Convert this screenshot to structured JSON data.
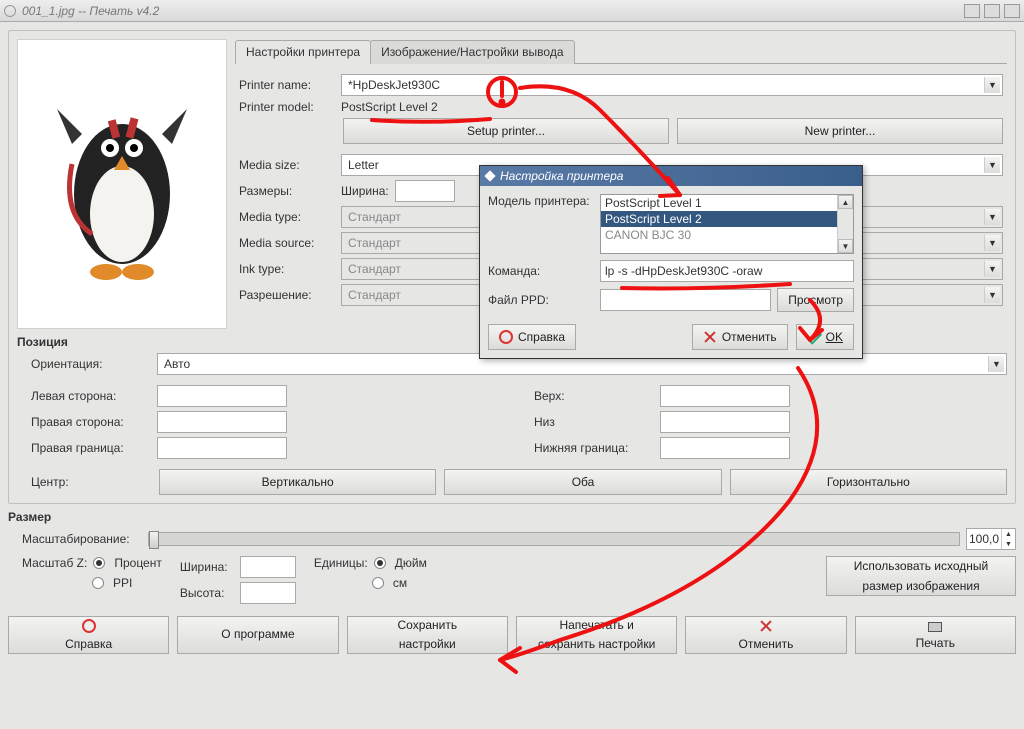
{
  "window": {
    "title": "001_1.jpg -- Печать v4.2"
  },
  "tabs": {
    "printer_settings": "Настройки принтера",
    "image_output": "Изображение/Настройки вывода"
  },
  "printer": {
    "name_label": "Printer name:",
    "name_value": "*HpDeskJet930C",
    "model_label": "Printer model:",
    "model_value": "PostScript Level 2",
    "setup_btn": "Setup printer...",
    "new_btn": "New printer..."
  },
  "media": {
    "size_label": "Media size:",
    "size_value": "Letter",
    "dims_label": "Размеры:",
    "width_label": "Ширина:",
    "type_label": "Media type:",
    "type_value": "Стандарт",
    "source_label": "Media source:",
    "source_value": "Стандарт",
    "ink_label": "Ink type:",
    "ink_value": "Стандарт",
    "res_label": "Разрешение:",
    "res_value": "Стандарт"
  },
  "position": {
    "group": "Позиция",
    "orient_label": "Ориентация:",
    "orient_value": "Авто",
    "left_label": "Левая сторона:",
    "top_label": "Верх:",
    "right_label": "Правая сторона:",
    "bottom_label": "Низ",
    "right_bound_label": "Правая граница:",
    "bottom_bound_label": "Нижняя граница:",
    "center_label": "Центр:",
    "center_vert": "Вертикально",
    "center_both": "Оба",
    "center_horiz": "Горизонтально"
  },
  "size": {
    "group": "Размер",
    "scaling_label": "Масштабирование:",
    "scale_value": "100,0",
    "scale_z_label": "Масштаб Z:",
    "percent": "Процент",
    "ppi": "PPI",
    "width_label": "Ширина:",
    "height_label": "Высота:",
    "units_label": "Единицы:",
    "inch": "Дюйм",
    "cm": "см",
    "orig_size_btn_l1": "Использовать исходный",
    "orig_size_btn_l2": "размер изображения"
  },
  "footer": {
    "help": "Справка",
    "about": "О программе",
    "save_l1": "Сохранить",
    "save_l2": "настройки",
    "print_save_l1": "Напечатать и",
    "print_save_l2": "сохранить настройки",
    "cancel": "Отменить",
    "print": "Печать"
  },
  "dialog": {
    "title": "Настройка принтера",
    "model_label": "Модель принтера:",
    "list": {
      "opt1": "PostScript Level 1",
      "opt2": "PostScript Level 2",
      "opt3": "CANON BJC 30"
    },
    "command_label": "Команда:",
    "command_value": "lp -s -dHpDeskJet930C -oraw",
    "ppd_label": "Файл PPD:",
    "browse": "Просмотр",
    "help": "Справка",
    "cancel": "Отменить",
    "ok": "OK"
  }
}
